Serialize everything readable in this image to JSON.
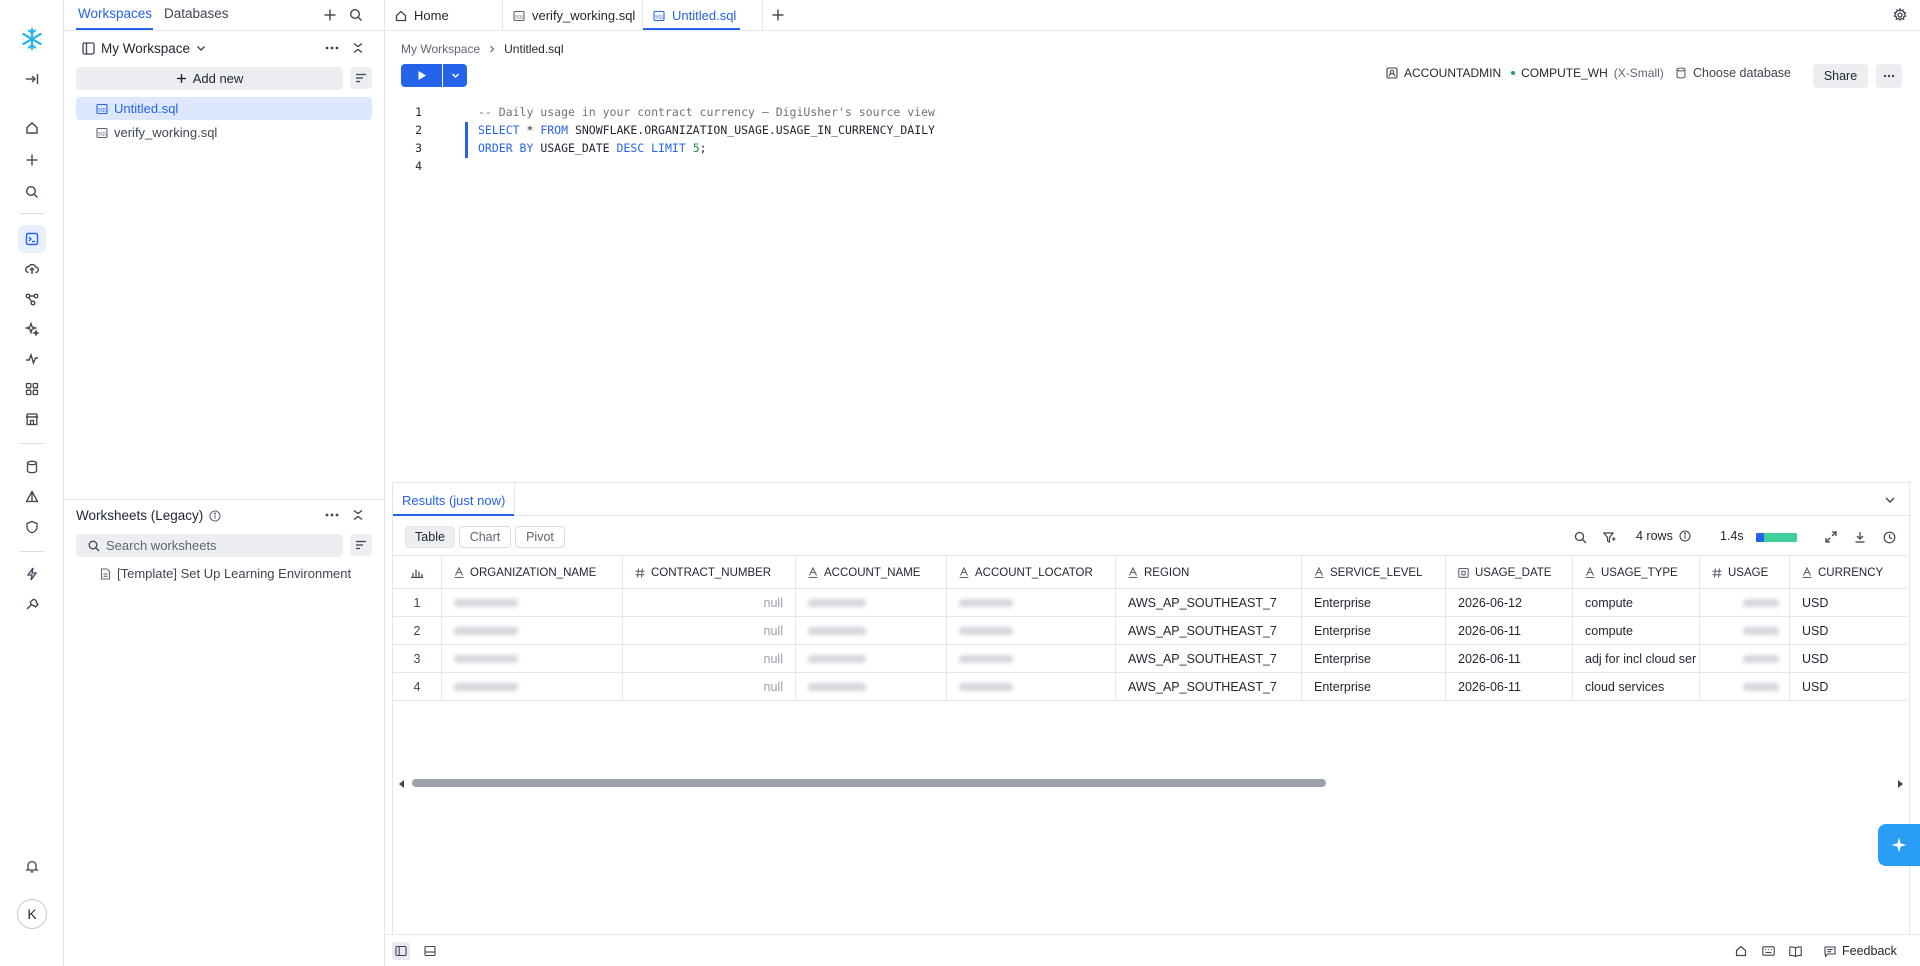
{
  "panel": {
    "tabs": [
      "Workspaces",
      "Databases"
    ],
    "workspace_name": "My Workspace",
    "add_new_label": "Add new",
    "files": [
      "Untitled.sql",
      "verify_working.sql"
    ],
    "legacy_title": "Worksheets (Legacy)",
    "search_placeholder": "Search worksheets",
    "template_item": "[Template] Set Up Learning Environment"
  },
  "tabs": {
    "home": "Home",
    "verify": "verify_working.sql",
    "untitled": "Untitled.sql"
  },
  "editor": {
    "breadcrumb_root": "My Workspace",
    "breadcrumb_current": "Untitled.sql",
    "role": "ACCOUNTADMIN",
    "warehouse": "COMPUTE_WH",
    "warehouse_size": "(X-Small)",
    "choose_db": "Choose database",
    "share": "Share",
    "line_numbers": [
      "1",
      "2",
      "3",
      "4"
    ],
    "code": {
      "l1_comment": "-- Daily usage in your contract currency — DigiUsher's source view",
      "l2_select": "SELECT",
      "l2_star": " * ",
      "l2_from": "FROM",
      "l2_rest": " SNOWFLAKE.ORGANIZATION_USAGE.USAGE_IN_CURRENCY_DAILY",
      "l3_order": "ORDER BY",
      "l3_col": " USAGE_DATE ",
      "l3_desc": "DESC",
      "l3_sp": " ",
      "l3_limit": "LIMIT",
      "l3_sp2": " ",
      "l3_num": "5",
      "l3_semi": ";"
    }
  },
  "results": {
    "title": "Results (just now)",
    "views": [
      "Table",
      "Chart",
      "Pivot"
    ],
    "rows_label": "4 rows",
    "duration": "1.4s",
    "duration_bar_fraction": 0.2,
    "columns": [
      "ORGANIZATION_NAME",
      "CONTRACT_NUMBER",
      "ACCOUNT_NAME",
      "ACCOUNT_LOCATOR",
      "REGION",
      "SERVICE_LEVEL",
      "USAGE_DATE",
      "USAGE_TYPE",
      "USAGE",
      "CURRENCY"
    ],
    "rows": [
      {
        "idx": "1",
        "contract": "null",
        "region": "AWS_AP_SOUTHEAST_7",
        "service": "Enterprise",
        "date": "2026-06-12",
        "type": "compute",
        "currency": "USD"
      },
      {
        "idx": "2",
        "contract": "null",
        "region": "AWS_AP_SOUTHEAST_7",
        "service": "Enterprise",
        "date": "2026-06-11",
        "type": "compute",
        "currency": "USD"
      },
      {
        "idx": "3",
        "contract": "null",
        "region": "AWS_AP_SOUTHEAST_7",
        "service": "Enterprise",
        "date": "2026-06-11",
        "type": "adj for incl cloud ser",
        "currency": "USD"
      },
      {
        "idx": "4",
        "contract": "null",
        "region": "AWS_AP_SOUTHEAST_7",
        "service": "Enterprise",
        "date": "2026-06-11",
        "type": "cloud services",
        "currency": "USD"
      }
    ]
  },
  "bottom": {
    "feedback": "Feedback"
  },
  "avatar_initial": "K",
  "colors": {
    "accent": "#2563eb",
    "logo": "#29b5e8",
    "duration_bar": "#3ecf9c"
  }
}
